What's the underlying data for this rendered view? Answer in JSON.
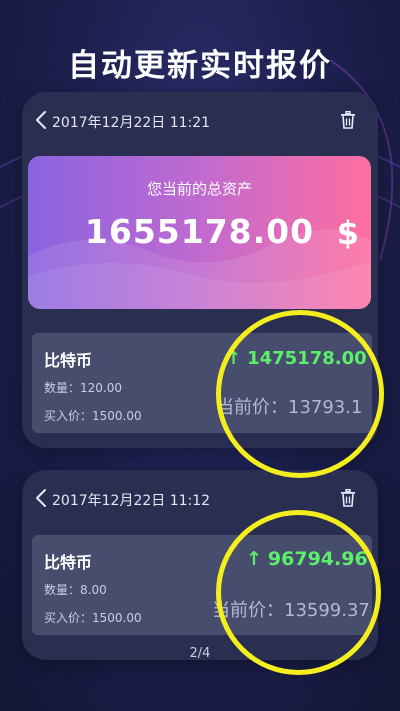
{
  "headline": "自动更新实时报价",
  "cards": [
    {
      "date": "2017年12月22日 11:21",
      "asset_label": "您当前的总资产",
      "asset_value": "1655178.00",
      "currency_symbol": "$",
      "coin": "比特币",
      "quantity": "数量：120.00",
      "buy_price": "买入价：1500.00",
      "gain": "1475178.00",
      "current_price": "当前价：13793.1"
    },
    {
      "date": "2017年12月22日 11:12",
      "coin": "比特币",
      "quantity": "数量：8.00",
      "buy_price": "买入价：1500.00",
      "gain": "96794.96",
      "current_price": "当前价：13599.37"
    }
  ],
  "pager": "2/4",
  "colors": {
    "gain": "#5cf06a",
    "highlight_ring": "#f4ee1e",
    "banner_start": "#8a63e0",
    "banner_end": "#ff6ea0"
  },
  "icons": [
    "back-chevron-icon",
    "trash-icon",
    "up-arrow-icon"
  ]
}
